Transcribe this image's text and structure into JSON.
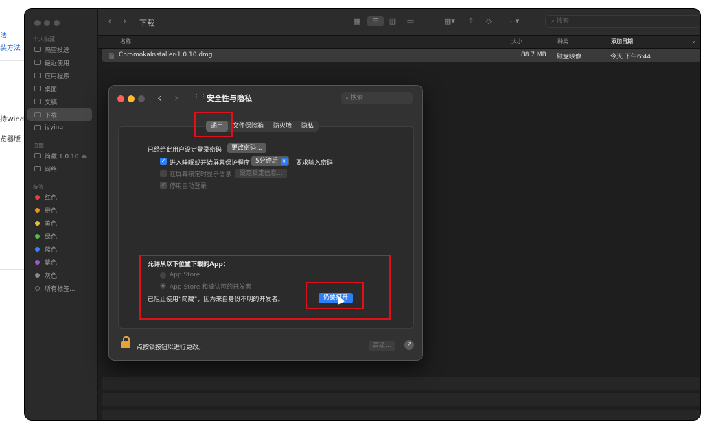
{
  "background_page": {
    "lines": [
      "法",
      "装方法",
      "持Windo",
      "览器版"
    ]
  },
  "finder": {
    "title": "下载",
    "sidebar": {
      "sections": {
        "favorites": "个人收藏",
        "locations": "位置",
        "tags": "标签"
      },
      "favorites": [
        "隔空投送",
        "最近使用",
        "应用程序",
        "桌面",
        "文稿",
        "下载",
        "jyying"
      ],
      "locations": [
        "简藏 1.0.10",
        "网络"
      ],
      "tags": [
        {
          "label": "红色",
          "color": "#e0443e"
        },
        {
          "label": "橙色",
          "color": "#e8912a"
        },
        {
          "label": "黄色",
          "color": "#d9c23a"
        },
        {
          "label": "绿色",
          "color": "#4cbf4a"
        },
        {
          "label": "蓝色",
          "color": "#3b82f0"
        },
        {
          "label": "紫色",
          "color": "#9b59d0"
        },
        {
          "label": "灰色",
          "color": "#8a8a8a"
        },
        {
          "label": "所有标签...",
          "color": ""
        }
      ]
    },
    "search_placeholder": "搜索",
    "columns": {
      "name": "名称",
      "size": "大小",
      "kind": "种类",
      "date": "添加日期"
    },
    "files": [
      {
        "name": "ChromokaInstaller-1.0.10.dmg",
        "size": "88.7 MB",
        "kind": "磁盘映像",
        "date": "今天 下午6:44"
      }
    ]
  },
  "prefs": {
    "title": "安全性与隐私",
    "search_placeholder": "搜索",
    "tabs": [
      "通用",
      "文件保险箱",
      "防火墙",
      "隐私"
    ],
    "password_label": "已经给此用户设定登录密码",
    "change_password_button": "更改密码...",
    "sleep_check_label": "进入睡眠或开始屏幕保护程序",
    "sleep_select": "5分钟后",
    "require_password_label": "要求输入密码",
    "lock_message_label": "在屏幕锁定时显示信息",
    "set_lock_message_button": "设定锁定信息...",
    "disable_autologin_label": "停用自动登录",
    "allow_apps_heading": "允许从以下位置下载的App：",
    "option_app_store": "App Store",
    "option_identified": "App Store 和被认可的开发者",
    "blocked_message": "已阻止使用“简藏”，因为来自身份不明的开发者。",
    "open_anyway_button": "仍要打开",
    "lock_label": "点按锁按钮以进行更改。",
    "advanced_button": "高级...",
    "help_button": "?"
  },
  "highlight_color": "#e0101a"
}
